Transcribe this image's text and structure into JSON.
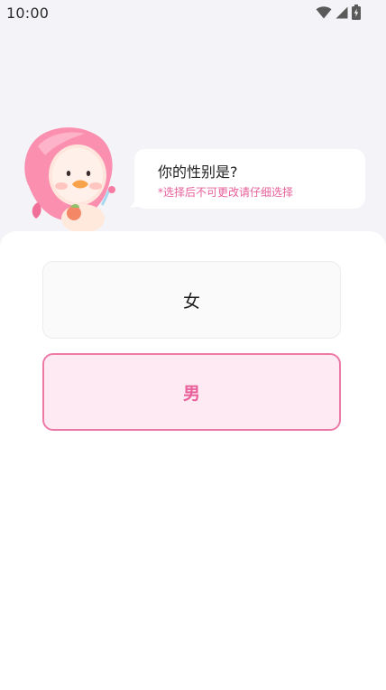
{
  "status_bar": {
    "time": "10:00",
    "icons": [
      "wifi-icon",
      "cellular-signal-icon",
      "battery-charging-icon"
    ]
  },
  "prompt": {
    "question": "你的性别是?",
    "hint": "*选择后不可更改请仔细选择"
  },
  "options": [
    {
      "label": "女",
      "selected": false
    },
    {
      "label": "男",
      "selected": true
    }
  ],
  "colors": {
    "accent": "#e9609b",
    "selected_border": "#ec7aa7",
    "selected_bg": "#feeaf2",
    "page_bg": "#f4f4f8"
  },
  "mascot": {
    "icon": "peach-mascot-illustration"
  }
}
